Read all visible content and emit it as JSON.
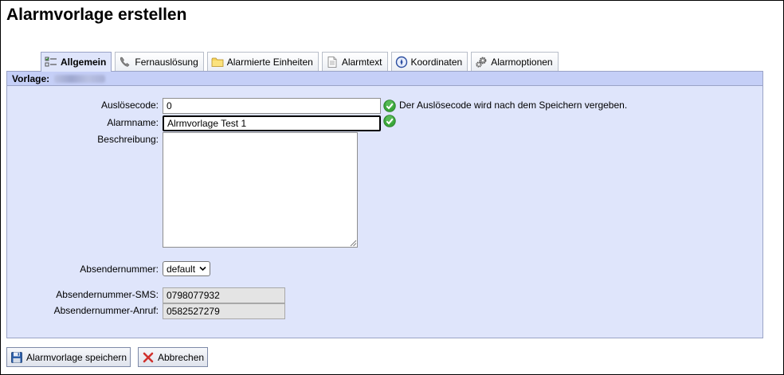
{
  "page": {
    "title": "Alarmvorlage erstellen"
  },
  "tabs": [
    {
      "label": "Allgemein",
      "icon": "checklist-icon",
      "active": true
    },
    {
      "label": "Fernauslösung",
      "icon": "phone-icon",
      "active": false
    },
    {
      "label": "Alarmierte Einheiten",
      "icon": "folder-icon",
      "active": false
    },
    {
      "label": "Alarmtext",
      "icon": "document-icon",
      "active": false
    },
    {
      "label": "Koordinaten",
      "icon": "compass-icon",
      "active": false
    },
    {
      "label": "Alarmoptionen",
      "icon": "gears-icon",
      "active": false
    }
  ],
  "panel": {
    "header_label": "Vorlage:"
  },
  "form": {
    "trigger_code": {
      "label": "Auslösecode:",
      "value": "0",
      "hint": "Der Auslösecode wird nach dem Speichern vergeben."
    },
    "alarm_name": {
      "label": "Alarmname:",
      "value": "Alrmvorlage Test 1"
    },
    "description": {
      "label": "Beschreibung:",
      "value": ""
    },
    "sender_number": {
      "label": "Absendernummer:",
      "selected": "default"
    },
    "sender_sms": {
      "label": "Absendernummer-SMS:",
      "value": "0798077932"
    },
    "sender_call": {
      "label": "Absendernummer-Anruf:",
      "value": "0582527279"
    }
  },
  "buttons": {
    "save_label": "Alarmvorlage speichern",
    "cancel_label": "Abbrechen"
  },
  "colors": {
    "panel_background": "#dfe5fb",
    "panel_header": "#c5cff7",
    "ok_green": "#3aa63a",
    "cancel_red": "#d0312d",
    "save_blue": "#2c5ea8"
  }
}
